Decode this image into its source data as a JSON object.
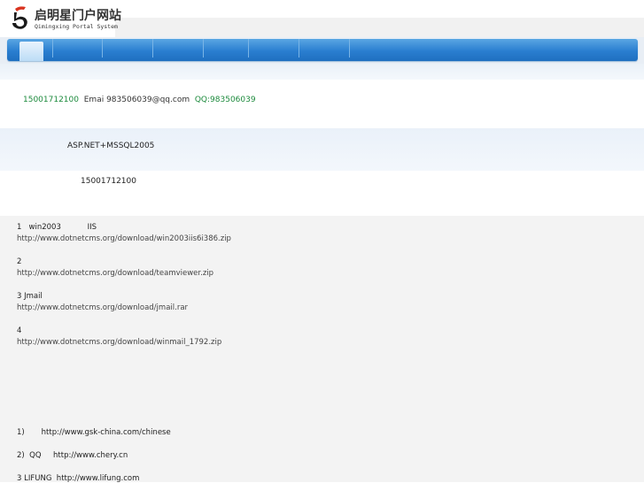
{
  "header": {
    "logo_title": "启明星门户网站",
    "logo_subtitle": "Qimingxing Portal System"
  },
  "nav": {
    "items": [
      "",
      "",
      "",
      "",
      "",
      "",
      ""
    ]
  },
  "contact": {
    "phone": "15001712100",
    "email": "Emai 983506039@qq.com",
    "qq": "QQ:983506039"
  },
  "tech": "ASP.NET+MSSQL2005",
  "phone2": "15001712100",
  "downloads": [
    {
      "label": "1   win2003           IIS",
      "url": "http://www.dotnetcms.org/download/win2003iis6i386.zip"
    },
    {
      "label": "2",
      "url": "http://www.dotnetcms.org/download/teamviewer.zip"
    },
    {
      "label": "3 Jmail",
      "url": "http://www.dotnetcms.org/download/jmail.rar"
    },
    {
      "label": "4",
      "url": "http://www.dotnetcms.org/download/winmail_1792.zip"
    }
  ],
  "clients": [
    "1)       http://www.gsk-china.com/chinese",
    "2)  QQ     http://www.chery.cn",
    "3 LIFUNG  http://www.lifung.com"
  ]
}
